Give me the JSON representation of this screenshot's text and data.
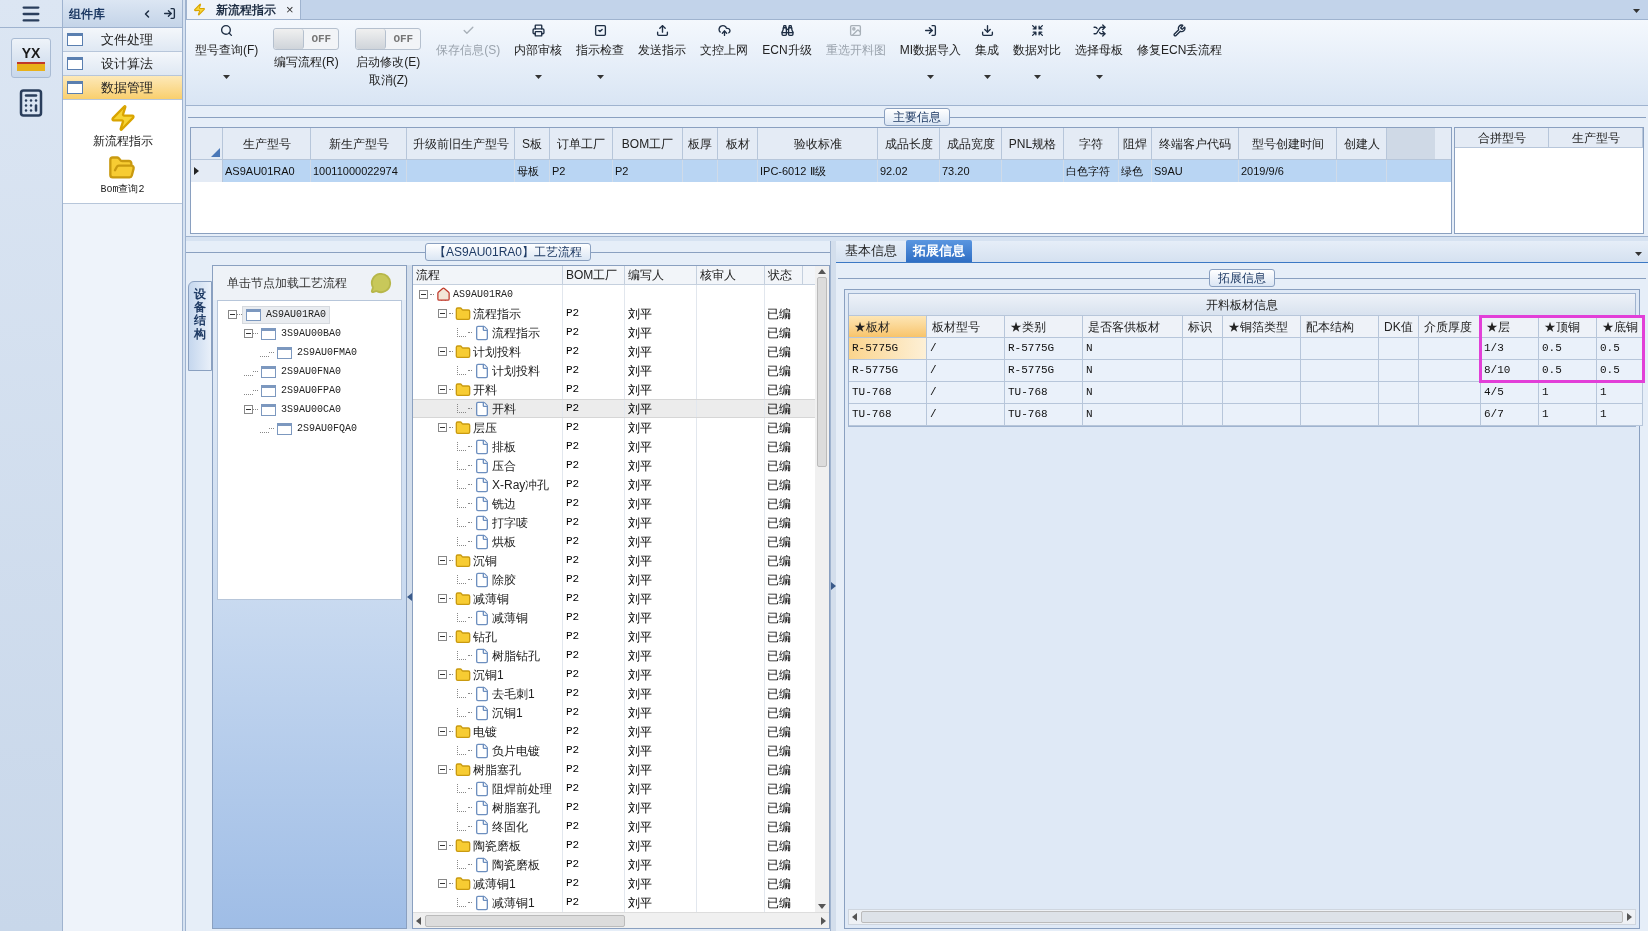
{
  "logo_text": "YX",
  "component_panel": {
    "title": "组件库",
    "items": [
      {
        "label": "文件处理",
        "selected": false
      },
      {
        "label": "设计算法",
        "selected": false
      },
      {
        "label": "数据管理",
        "selected": true
      }
    ],
    "shortcuts": [
      {
        "kind": "lightning",
        "label": "新流程指示"
      },
      {
        "kind": "folder",
        "label": "Bom查询2"
      }
    ]
  },
  "document_tab": {
    "label": "新流程指示",
    "close": "×",
    "selected": true
  },
  "toolbar": [
    {
      "kind": "button",
      "label": "型号查询(F)",
      "dropdown": true,
      "disabled": false
    },
    {
      "kind": "toggle",
      "label": "编写流程(R)",
      "state_text": "OFF",
      "on": false
    },
    {
      "kind": "toggle",
      "label": "启动修改(E)",
      "sublabel": "取消(Z)",
      "state_text": "OFF",
      "on": false
    },
    {
      "kind": "button",
      "label": "保存信息(S)",
      "dropdown": false,
      "disabled": true
    },
    {
      "kind": "button",
      "label": "内部审核",
      "dropdown": true,
      "disabled": false
    },
    {
      "kind": "button",
      "label": "指示检查",
      "dropdown": true,
      "disabled": false
    },
    {
      "kind": "button",
      "label": "发送指示",
      "dropdown": false,
      "disabled": false
    },
    {
      "kind": "button",
      "label": "文控上网",
      "dropdown": false,
      "disabled": false
    },
    {
      "kind": "button",
      "label": "ECN升级",
      "dropdown": false,
      "disabled": false
    },
    {
      "kind": "button",
      "label": "重选开料图",
      "dropdown": false,
      "disabled": true
    },
    {
      "kind": "button",
      "label": "MI数据导入",
      "dropdown": true,
      "disabled": false
    },
    {
      "kind": "button",
      "label": "集成",
      "dropdown": true,
      "disabled": false
    },
    {
      "kind": "button",
      "label": "数据对比",
      "dropdown": true,
      "disabled": false
    },
    {
      "kind": "button",
      "label": "选择母板",
      "dropdown": true,
      "disabled": false
    },
    {
      "kind": "button",
      "label": "修复ECN丢流程",
      "dropdown": false,
      "disabled": false
    }
  ],
  "main_info": {
    "title": "主要信息",
    "columns": [
      "生产型号",
      "新生产型号",
      "升级前旧生产型号",
      "S板",
      "订单工厂",
      "BOM工厂",
      "板厚",
      "板材",
      "验收标准",
      "成品长度",
      "成品宽度",
      "PNL规格",
      "字符",
      "阻焊",
      "终端客户代码",
      "型号创建时间",
      "创建人"
    ],
    "rows": [
      {
        "selected": true,
        "cells": [
          "AS9AU01RA0",
          "10011000022974",
          null,
          "母板",
          "P2",
          "P2",
          null,
          null,
          "IPC-6012 Ⅱ级",
          "92.02",
          "73.20",
          null,
          "白色字符",
          "绿色",
          "S9AU",
          "2019/9/6",
          null
        ]
      }
    ],
    "merge_table": {
      "columns": [
        "合拼型号",
        "生产型号"
      ]
    }
  },
  "flow_panel": {
    "title": "【AS9AU01RA0】工艺流程",
    "side_tab": "设备结构",
    "hint": "单击节点加载工艺流程",
    "device_tree": [
      {
        "label": "AS9AU01RA0",
        "selected": true,
        "children": [
          {
            "label": "3S9AU00BA0",
            "selected": false,
            "children": [
              {
                "label": "2S9AU0FMA0",
                "selected": false
              }
            ]
          },
          {
            "label": "2S9AU0FNA0",
            "selected": false
          },
          {
            "label": "2S9AU0FPA0",
            "selected": false
          },
          {
            "label": "3S9AU00CA0",
            "selected": false,
            "children": [
              {
                "label": "2S9AU0FQA0",
                "selected": false
              }
            ]
          }
        ]
      }
    ],
    "columns": [
      "流程",
      "BOM工厂",
      "编写人",
      "核审人",
      "状态"
    ],
    "flow_tree": [
      {
        "kind": "root",
        "label": "AS9AU01RA0",
        "selected": false,
        "children": [
          {
            "kind": "folder",
            "label": "流程指示",
            "bom": "P2",
            "writer": "刘平",
            "status": "已编",
            "selected": false,
            "children": [
              {
                "kind": "file",
                "label": "流程指示",
                "bom": "P2",
                "writer": "刘平",
                "status": "已编",
                "selected": false
              }
            ]
          },
          {
            "kind": "folder",
            "label": "计划投料",
            "bom": "P2",
            "writer": "刘平",
            "status": "已编",
            "selected": false,
            "children": [
              {
                "kind": "file",
                "label": "计划投料",
                "bom": "P2",
                "writer": "刘平",
                "status": "已编",
                "selected": false
              }
            ]
          },
          {
            "kind": "folder",
            "label": "开料",
            "bom": "P2",
            "writer": "刘平",
            "status": "已编",
            "selected": false,
            "children": [
              {
                "kind": "file",
                "label": "开料",
                "bom": "P2",
                "writer": "刘平",
                "status": "已编",
                "selected": true
              }
            ]
          },
          {
            "kind": "folder",
            "label": "层压",
            "bom": "P2",
            "writer": "刘平",
            "status": "已编",
            "selected": false,
            "children": [
              {
                "kind": "file",
                "label": "排板",
                "bom": "P2",
                "writer": "刘平",
                "status": "已编",
                "selected": false
              },
              {
                "kind": "file",
                "label": "压合",
                "bom": "P2",
                "writer": "刘平",
                "status": "已编",
                "selected": false
              },
              {
                "kind": "file",
                "label": "X-Ray冲孔",
                "bom": "P2",
                "writer": "刘平",
                "status": "已编",
                "selected": false
              },
              {
                "kind": "file",
                "label": "铣边",
                "bom": "P2",
                "writer": "刘平",
                "status": "已编",
                "selected": false
              },
              {
                "kind": "file",
                "label": "打字唛",
                "bom": "P2",
                "writer": "刘平",
                "status": "已编",
                "selected": false
              },
              {
                "kind": "file",
                "label": "烘板",
                "bom": "P2",
                "writer": "刘平",
                "status": "已编",
                "selected": false
              }
            ]
          },
          {
            "kind": "folder",
            "label": "沉铜",
            "bom": "P2",
            "writer": "刘平",
            "status": "已编",
            "selected": false,
            "children": [
              {
                "kind": "file",
                "label": "除胶",
                "bom": "P2",
                "writer": "刘平",
                "status": "已编",
                "selected": false
              }
            ]
          },
          {
            "kind": "folder",
            "label": "减薄铜",
            "bom": "P2",
            "writer": "刘平",
            "status": "已编",
            "selected": false,
            "children": [
              {
                "kind": "file",
                "label": "减薄铜",
                "bom": "P2",
                "writer": "刘平",
                "status": "已编",
                "selected": false
              }
            ]
          },
          {
            "kind": "folder",
            "label": "钻孔",
            "bom": "P2",
            "writer": "刘平",
            "status": "已编",
            "selected": false,
            "children": [
              {
                "kind": "file",
                "label": "树脂钻孔",
                "bom": "P2",
                "writer": "刘平",
                "status": "已编",
                "selected": false
              }
            ]
          },
          {
            "kind": "folder",
            "label": "沉铜1",
            "bom": "P2",
            "writer": "刘平",
            "status": "已编",
            "selected": false,
            "children": [
              {
                "kind": "file",
                "label": "去毛刺1",
                "bom": "P2",
                "writer": "刘平",
                "status": "已编",
                "selected": false
              },
              {
                "kind": "file",
                "label": "沉铜1",
                "bom": "P2",
                "writer": "刘平",
                "status": "已编",
                "selected": false
              }
            ]
          },
          {
            "kind": "folder",
            "label": "电镀",
            "bom": "P2",
            "writer": "刘平",
            "status": "已编",
            "selected": false,
            "children": [
              {
                "kind": "file",
                "label": "负片电镀",
                "bom": "P2",
                "writer": "刘平",
                "status": "已编",
                "selected": false
              }
            ]
          },
          {
            "kind": "folder",
            "label": "树脂塞孔",
            "bom": "P2",
            "writer": "刘平",
            "status": "已编",
            "selected": false,
            "children": [
              {
                "kind": "file",
                "label": "阻焊前处理",
                "bom": "P2",
                "writer": "刘平",
                "status": "已编",
                "selected": false
              },
              {
                "kind": "file",
                "label": "树脂塞孔",
                "bom": "P2",
                "writer": "刘平",
                "status": "已编",
                "selected": false
              },
              {
                "kind": "file",
                "label": "终固化",
                "bom": "P2",
                "writer": "刘平",
                "status": "已编",
                "selected": false
              }
            ]
          },
          {
            "kind": "folder",
            "label": "陶瓷磨板",
            "bom": "P2",
            "writer": "刘平",
            "status": "已编",
            "selected": false,
            "children": [
              {
                "kind": "file",
                "label": "陶瓷磨板",
                "bom": "P2",
                "writer": "刘平",
                "status": "已编",
                "selected": false
              }
            ]
          },
          {
            "kind": "folder",
            "label": "减薄铜1",
            "bom": "P2",
            "writer": "刘平",
            "status": "已编",
            "selected": false,
            "children": [
              {
                "kind": "file",
                "label": "减薄铜1",
                "bom": "P2",
                "writer": "刘平",
                "status": "已编",
                "selected": false
              }
            ]
          }
        ]
      }
    ]
  },
  "detail_panel": {
    "tabs": [
      {
        "label": "基本信息",
        "selected": false
      },
      {
        "label": "拓展信息",
        "selected": true
      }
    ],
    "title": "拓展信息",
    "table_title": "开料板材信息",
    "columns": [
      {
        "label": "★板材",
        "selected": true,
        "highlighted": false
      },
      {
        "label": "板材型号",
        "selected": false,
        "highlighted": false
      },
      {
        "label": "★类别",
        "selected": false,
        "highlighted": false
      },
      {
        "label": "是否客供板材",
        "selected": false,
        "highlighted": false
      },
      {
        "label": "标识",
        "selected": false,
        "highlighted": false
      },
      {
        "label": "★铜箔类型",
        "selected": false,
        "highlighted": false
      },
      {
        "label": "配本结构",
        "selected": false,
        "highlighted": false
      },
      {
        "label": "DK值",
        "selected": false,
        "highlighted": false
      },
      {
        "label": "介质厚度",
        "selected": false,
        "highlighted": false
      },
      {
        "label": "★层",
        "selected": false,
        "highlighted": true
      },
      {
        "label": "★顶铜",
        "selected": false,
        "highlighted": true
      },
      {
        "label": "★底铜",
        "selected": false,
        "highlighted": true
      }
    ],
    "rows": [
      {
        "selected": true,
        "highlighted": true,
        "cells": [
          "R-5775G",
          "/",
          "R-5775G",
          "N",
          null,
          null,
          null,
          null,
          null,
          "1/3",
          "0.5",
          "0.5"
        ]
      },
      {
        "selected": false,
        "highlighted": true,
        "cells": [
          "R-5775G",
          "/",
          "R-5775G",
          "N",
          null,
          null,
          null,
          null,
          null,
          "8/10",
          "0.5",
          "0.5"
        ]
      },
      {
        "selected": false,
        "highlighted": false,
        "cells": [
          "TU-768",
          "/",
          "TU-768",
          "N",
          null,
          null,
          null,
          null,
          null,
          "4/5",
          "1",
          "1"
        ]
      },
      {
        "selected": false,
        "highlighted": false,
        "cells": [
          "TU-768",
          "/",
          "TU-768",
          "N",
          null,
          null,
          null,
          null,
          null,
          "6/7",
          "1",
          "1"
        ]
      }
    ]
  }
}
